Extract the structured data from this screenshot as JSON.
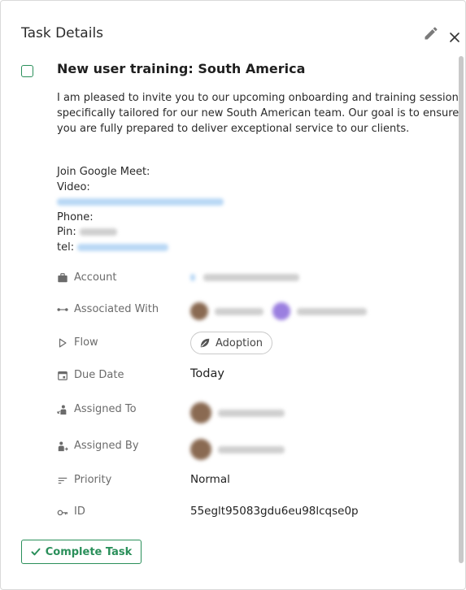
{
  "header": {
    "title": "Task Details"
  },
  "task": {
    "name": "New user training: South America",
    "description": "I am pleased to invite you to our upcoming onboarding and training session specifically tailored for our new South American team. Our goal is to ensure you are fully prepared to deliver exceptional service to our clients."
  },
  "meeting": {
    "join_label": "Join Google Meet:",
    "video_label": "Video:",
    "phone_label": "Phone:",
    "pin_label": "Pin:",
    "tel_label": "tel:"
  },
  "fields": {
    "account": {
      "label": "Account",
      "icon": "briefcase-icon"
    },
    "associated_with": {
      "label": "Associated With",
      "icon": "link-nodes-icon"
    },
    "flow": {
      "label": "Flow",
      "icon": "play-outline-icon",
      "value": "Adoption"
    },
    "due_date": {
      "label": "Due Date",
      "icon": "calendar-icon",
      "value": "Today"
    },
    "assigned_to": {
      "label": "Assigned To",
      "icon": "user-arrow-in-icon"
    },
    "assigned_by": {
      "label": "Assigned By",
      "icon": "user-arrow-out-icon"
    },
    "priority": {
      "label": "Priority",
      "icon": "sort-lines-icon",
      "value": "Normal"
    },
    "id": {
      "label": "ID",
      "icon": "key-icon",
      "value": "55eglt95083gdu6eu98lcqse0p"
    }
  },
  "actions": {
    "complete_label": "Complete Task"
  },
  "colors": {
    "accent": "#2a8f5a",
    "label": "#6b6b6b",
    "text": "#222222"
  }
}
